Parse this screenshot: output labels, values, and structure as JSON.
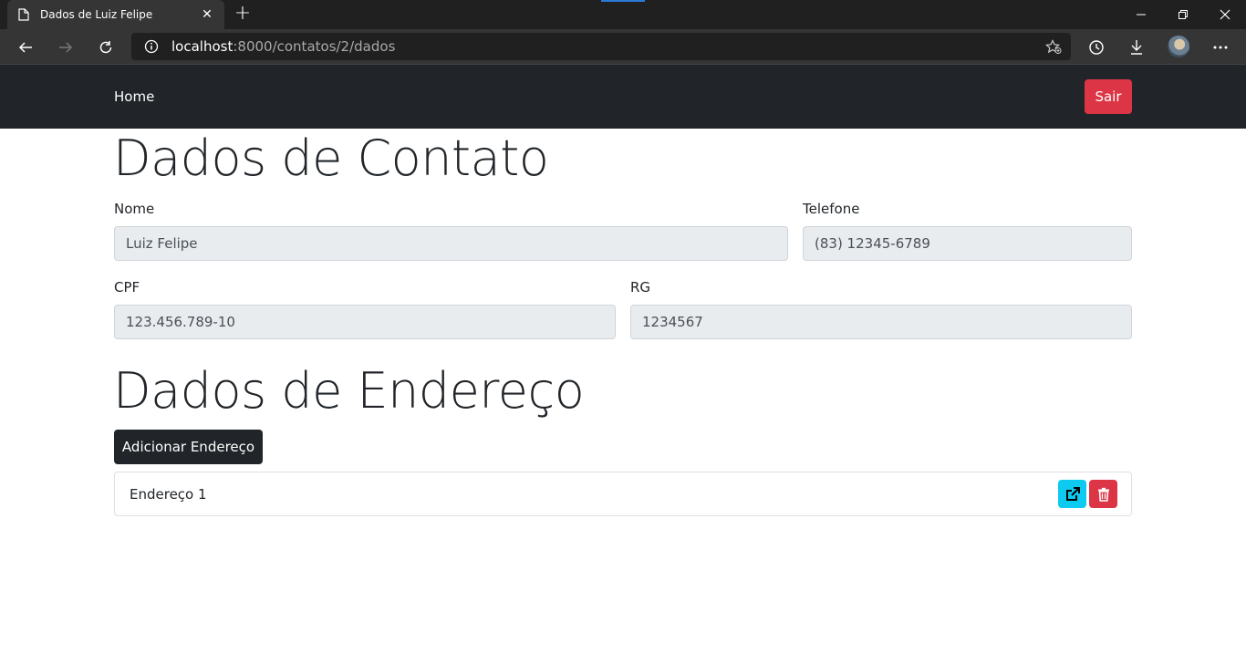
{
  "browser": {
    "tab_title": "Dados de Luiz Felipe",
    "url_host": "localhost",
    "url_rest": ":8000/contatos/2/dados"
  },
  "navbar": {
    "home_label": "Home",
    "logout_label": "Sair"
  },
  "contact": {
    "heading": "Dados de Contato",
    "fields": {
      "nome": {
        "label": "Nome",
        "value": "Luiz Felipe"
      },
      "telefone": {
        "label": "Telefone",
        "value": "(83) 12345-6789"
      },
      "cpf": {
        "label": "CPF",
        "value": "123.456.789-10"
      },
      "rg": {
        "label": "RG",
        "value": "1234567"
      }
    }
  },
  "address": {
    "heading": "Dados de Endereço",
    "add_button_label": "Adicionar Endereço",
    "items": [
      {
        "label": "Endereço 1"
      }
    ]
  },
  "colors": {
    "navbar_bg": "#212529",
    "danger": "#dc3545",
    "info": "#0dcaf0",
    "field_bg": "#e9ecef"
  },
  "icons": {
    "edit": "external-link-icon",
    "delete": "trash-icon"
  }
}
